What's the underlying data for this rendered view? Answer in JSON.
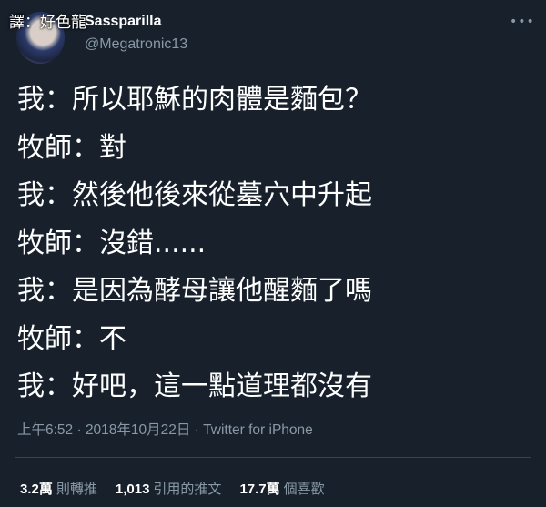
{
  "watermark": "譯：好色龍",
  "author": {
    "name": "Sassparilla",
    "handle": "@Megatronic13"
  },
  "more_icon": "ellipsis-icon",
  "lines": [
    "我：所以耶穌的肉體是麵包？",
    "牧師：對",
    "我：然後他後來從墓穴中升起",
    "牧師：沒錯......",
    "我：是因為酵母讓他醒麵了嗎",
    "牧師：不",
    "我：好吧，這一點道理都沒有"
  ],
  "meta": "上午6:52 · 2018年10月22日 · Twitter for iPhone",
  "stats": [
    {
      "count": "3.2萬",
      "label": "則轉推"
    },
    {
      "count": "1,013",
      "label": "引用的推文"
    },
    {
      "count": "17.7萬",
      "label": "個喜歡"
    }
  ]
}
